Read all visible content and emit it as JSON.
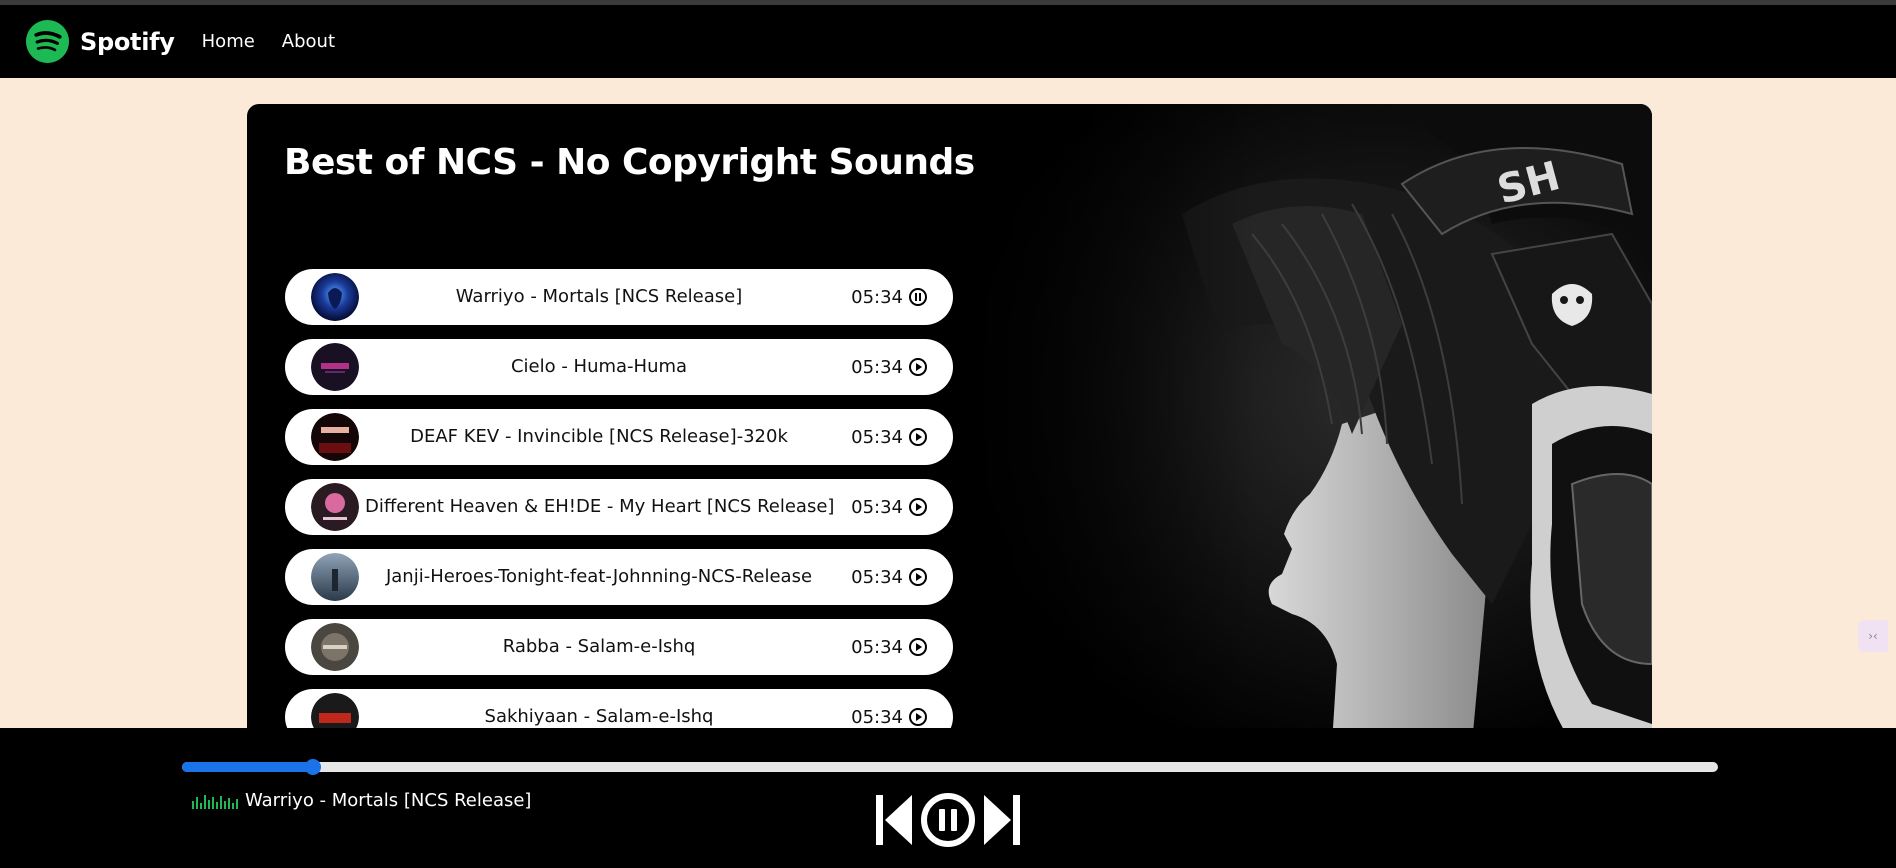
{
  "nav": {
    "brand": "Spotify",
    "links": [
      "Home",
      "About"
    ]
  },
  "playlist": {
    "title": "Best of NCS - No Copyright Sounds",
    "songs": [
      {
        "name": "Warriyo - Mortals [NCS Release]",
        "duration": "05:34",
        "state": "pause-icon"
      },
      {
        "name": "Cielo - Huma-Huma",
        "duration": "05:34",
        "state": "play-icon"
      },
      {
        "name": "DEAF KEV - Invincible [NCS Release]-320k",
        "duration": "05:34",
        "state": "play-icon"
      },
      {
        "name": "Different Heaven & EH!DE - My Heart [NCS Release]",
        "duration": "05:34",
        "state": "play-icon"
      },
      {
        "name": "Janji-Heroes-Tonight-feat-Johnning-NCS-Release",
        "duration": "05:34",
        "state": "play-icon"
      },
      {
        "name": "Rabba - Salam-e-Ishq",
        "duration": "05:34",
        "state": "play-icon"
      },
      {
        "name": "Sakhiyaan - Salam-e-Ishq",
        "duration": "05:34",
        "state": "play-icon"
      }
    ]
  },
  "player": {
    "progress": 0.085,
    "now_playing": "Warriyo - Mortals [NCS Release]",
    "controls": [
      "previous-icon",
      "pause-circle-icon",
      "next-icon"
    ]
  },
  "colors": {
    "page_bg": "#fbead7",
    "brand_green": "#1db954",
    "progress_accent": "#1a73e8",
    "eq_green": "#1db954"
  }
}
